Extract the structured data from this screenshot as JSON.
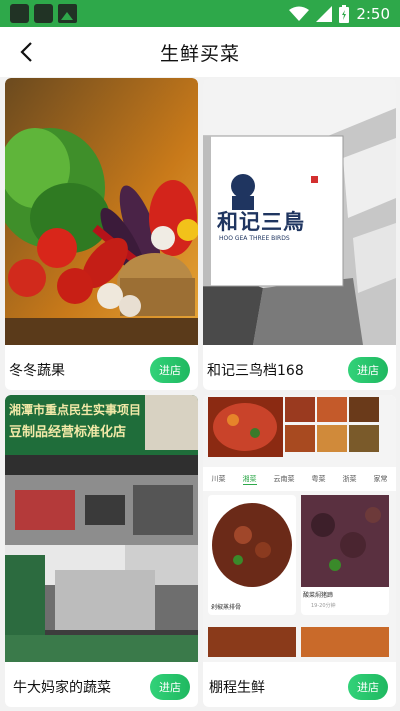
{
  "status_bar": {
    "time": "2:50"
  },
  "header": {
    "title": "生鲜买菜"
  },
  "stores": [
    {
      "name": "冬冬蔬果",
      "button": "进店"
    },
    {
      "name": "和记三鸟档168",
      "button": "进店"
    },
    {
      "name": "牛大妈家的蔬菜",
      "button": "进店"
    },
    {
      "name": "棚程生鲜",
      "button": "进店"
    }
  ],
  "signs": {
    "logo_text": "和记三鳥",
    "logo_sub": "HOO GEA THREE BIRDS",
    "banner_line1": "湘潭市重点民生实事项目",
    "banner_line2": "豆制品经营标准化店"
  },
  "food_app": {
    "tabs": [
      "川菜",
      "湘菜",
      "云南菜",
      "粤菜",
      "浙菜",
      "家常"
    ],
    "dishes": [
      {
        "name": "剁椒蒸排骨",
        "meta": ""
      },
      {
        "name": "酸菜焖猪蹄",
        "meta": "19-20分钟"
      }
    ]
  },
  "colors": {
    "status_green": "#2ea84a",
    "button_green": "#24c46a"
  }
}
